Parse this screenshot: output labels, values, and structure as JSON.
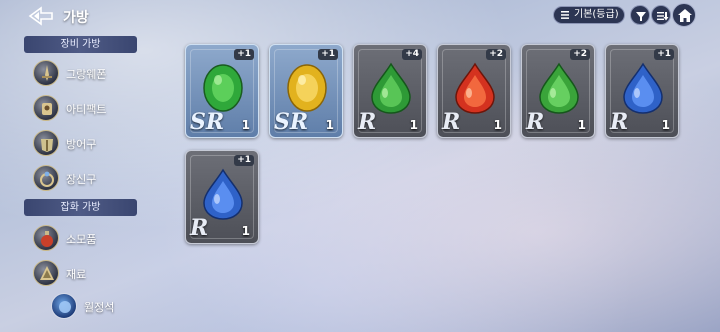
{
  "header": {
    "title": "가방",
    "sort_label": "기본(등급)"
  },
  "sidebar": {
    "sections": [
      {
        "label": "장비 가방"
      },
      {
        "label": "잡화 가방"
      }
    ],
    "items": [
      {
        "label": "그랑웨폰",
        "icon": "sword-icon"
      },
      {
        "label": "아티팩트",
        "icon": "artifact-icon"
      },
      {
        "label": "방어구",
        "icon": "armor-icon"
      },
      {
        "label": "장신구",
        "icon": "accessory-icon"
      },
      {
        "label": "소모품",
        "icon": "potion-icon"
      },
      {
        "label": "재료",
        "icon": "material-icon"
      },
      {
        "label": "월정석",
        "icon": "moonstone-icon"
      }
    ]
  },
  "items": [
    {
      "grade": "SR",
      "plus": "+1",
      "qty": "1",
      "gem": "emerald-oval",
      "color": "#2fa83a"
    },
    {
      "grade": "SR",
      "plus": "+1",
      "qty": "1",
      "gem": "topaz-oval",
      "color": "#e2b21e"
    },
    {
      "grade": "R",
      "plus": "+4",
      "qty": "1",
      "gem": "emerald-drop",
      "color": "#2e9a36"
    },
    {
      "grade": "R",
      "plus": "+2",
      "qty": "1",
      "gem": "ruby-drop",
      "color": "#d4321f"
    },
    {
      "grade": "R",
      "plus": "+2",
      "qty": "1",
      "gem": "emerald-drop",
      "color": "#3aa43a"
    },
    {
      "grade": "R",
      "plus": "+1",
      "qty": "1",
      "gem": "sapphire-drop",
      "color": "#2f62c8"
    },
    {
      "grade": "R",
      "plus": "+1",
      "qty": "1",
      "gem": "sapphire-drop",
      "color": "#2f62c8"
    }
  ]
}
